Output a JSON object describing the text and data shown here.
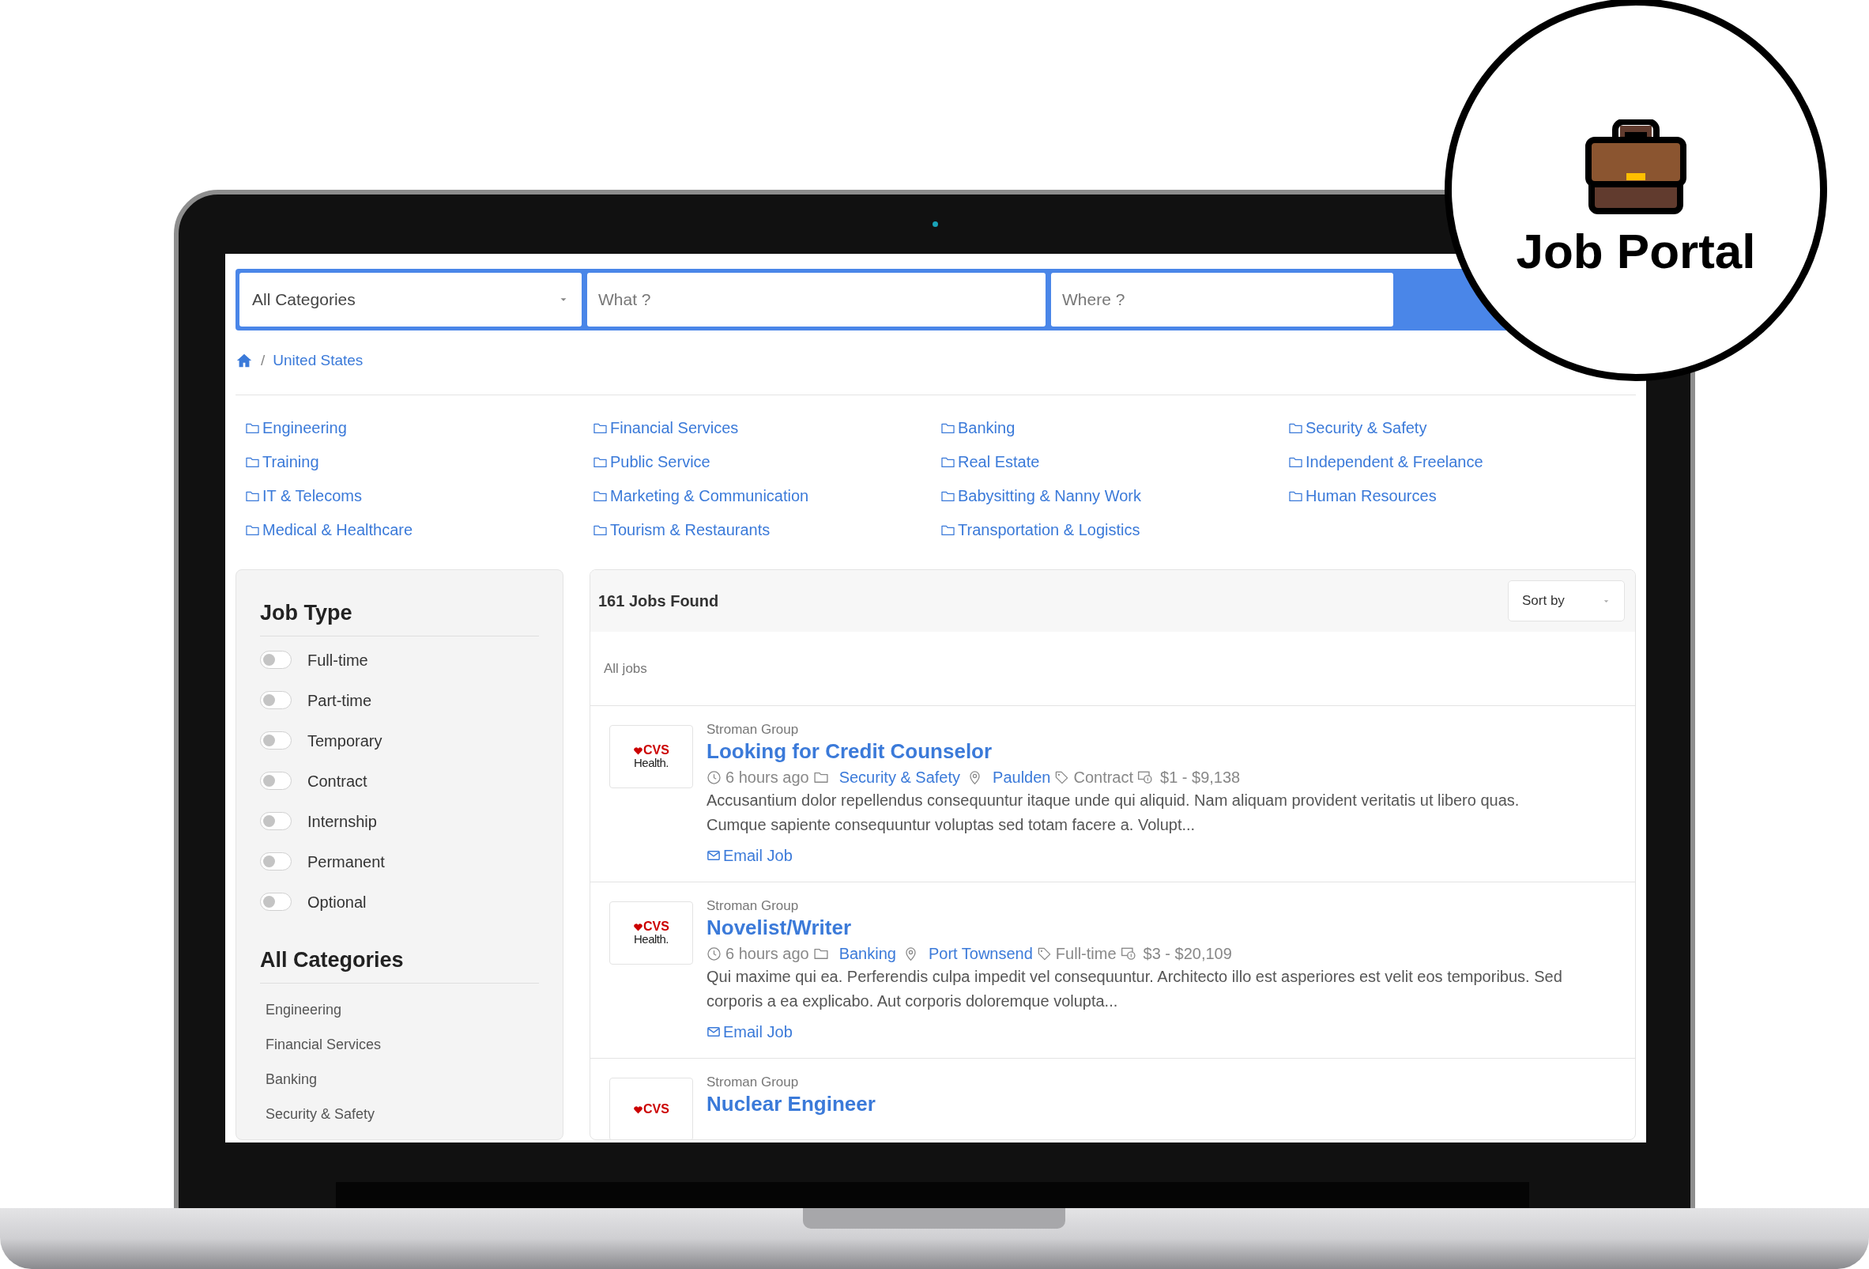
{
  "badge": {
    "title": "Job Portal"
  },
  "search": {
    "category": "All Categories",
    "what_placeholder": "What ?",
    "where_placeholder": "Where ?"
  },
  "breadcrumb": {
    "separator": "/",
    "items": [
      "United States"
    ]
  },
  "categories": [
    "Engineering",
    "Financial Services",
    "Banking",
    "Security & Safety",
    "Training",
    "Public Service",
    "Real Estate",
    "Independent & Freelance",
    "IT & Telecoms",
    "Marketing & Communication",
    "Babysitting & Nanny Work",
    "Human Resources",
    "Medical & Healthcare",
    "Tourism & Restaurants",
    "Transportation & Logistics"
  ],
  "sidebar": {
    "job_type": {
      "title": "Job Type",
      "options": [
        {
          "label": "Full-time",
          "on": false
        },
        {
          "label": "Part-time",
          "on": false
        },
        {
          "label": "Temporary",
          "on": false
        },
        {
          "label": "Contract",
          "on": false
        },
        {
          "label": "Internship",
          "on": false
        },
        {
          "label": "Permanent",
          "on": false
        },
        {
          "label": "Optional",
          "on": false
        }
      ]
    },
    "categories": {
      "title": "All Categories",
      "items": [
        "Engineering",
        "Financial Services",
        "Banking",
        "Security & Safety"
      ]
    }
  },
  "results": {
    "count": "161 Jobs Found",
    "sort": "Sort by",
    "subtitle": "All jobs",
    "jobs": [
      {
        "logo": [
          "CVS",
          "Health."
        ],
        "company": "Stroman Group",
        "title": "Looking for Credit Counselor",
        "posted": "6 hours ago",
        "category": "Security & Safety",
        "location": "Paulden",
        "type": "Contract",
        "salary": "$1 - $9,138",
        "description": "Accusantium dolor repellendus consequuntur itaque unde qui aliquid. Nam aliquam provident veritatis ut libero quas. Cumque sapiente consequuntur voluptas sed totam facere a. Volupt...",
        "email": "Email Job"
      },
      {
        "logo": [
          "CVS",
          "Health."
        ],
        "company": "Stroman Group",
        "title": "Novelist/Writer",
        "posted": "6 hours ago",
        "category": "Banking",
        "location": "Port Townsend",
        "type": "Full-time",
        "salary": "$3 - $20,109",
        "description": "Qui maxime qui ea. Perferendis culpa impedit vel consequuntur. Architecto illo est asperiores est velit eos temporibus. Sed corporis a ea explicabo. Aut corporis doloremque volupta...",
        "email": "Email Job"
      },
      {
        "logo": [
          "CVS"
        ],
        "company": "Stroman Group",
        "title": "Nuclear Engineer"
      }
    ]
  }
}
